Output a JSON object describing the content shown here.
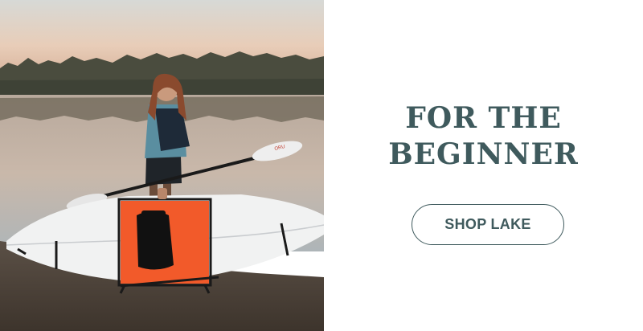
{
  "hero": {
    "image_alt": "Woman carrying a folding kayak and paddle by a lake at sunset",
    "headline_line1": "FOR THE",
    "headline_line2": "BEGINNER",
    "cta_label": "SHOP LAKE"
  },
  "colors": {
    "accent": "#3f5a5d",
    "background": "#ffffff",
    "kayak_seat": "#f25a2a"
  }
}
